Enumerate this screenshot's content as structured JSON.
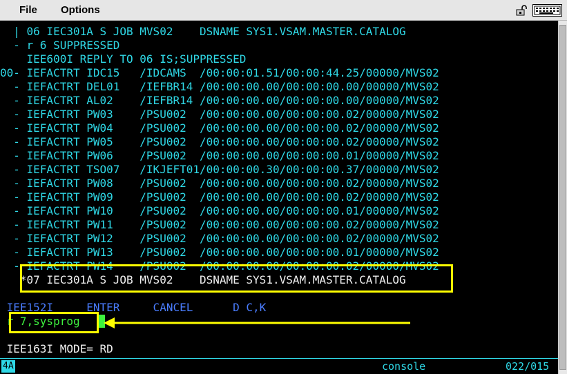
{
  "menubar": {
    "file_label": "File",
    "options_label": "Options",
    "icons": [
      "lock-icon",
      "keyboard-icon"
    ]
  },
  "console_lines": [
    {
      "text": "  | 06 IEC301A S JOB MVS02    DSNAME SYS1.VSAM.MASTER.CATALOG",
      "color": "cyan"
    },
    {
      "text": "  - r 6 SUPPRESSED",
      "color": "cyan"
    },
    {
      "text": "    IEE600I REPLY TO 06 IS;SUPPRESSED",
      "color": "cyan"
    },
    {
      "text": "00- IEFACTRT IDC15   /IDCAMS  /00:00:01.51/00:00:44.25/00000/MVS02",
      "color": "cyan"
    },
    {
      "text": "  - IEFACTRT DEL01   /IEFBR14 /00:00:00.00/00:00:00.00/00000/MVS02",
      "color": "cyan"
    },
    {
      "text": "  - IEFACTRT AL02    /IEFBR14 /00:00:00.00/00:00:00.00/00000/MVS02",
      "color": "cyan"
    },
    {
      "text": "  - IEFACTRT PW03    /PSU002  /00:00:00.00/00:00:00.02/00000/MVS02",
      "color": "cyan"
    },
    {
      "text": "  - IEFACTRT PW04    /PSU002  /00:00:00.00/00:00:00.02/00000/MVS02",
      "color": "cyan"
    },
    {
      "text": "  - IEFACTRT PW05    /PSU002  /00:00:00.00/00:00:00.02/00000/MVS02",
      "color": "cyan"
    },
    {
      "text": "  - IEFACTRT PW06    /PSU002  /00:00:00.00/00:00:00.01/00000/MVS02",
      "color": "cyan"
    },
    {
      "text": "  - IEFACTRT TSO07   /IKJEFT01/00:00:00.30/00:00:00.37/00000/MVS02",
      "color": "cyan"
    },
    {
      "text": "  - IEFACTRT PW08    /PSU002  /00:00:00.00/00:00:00.02/00000/MVS02",
      "color": "cyan"
    },
    {
      "text": "  - IEFACTRT PW09    /PSU002  /00:00:00.00/00:00:00.02/00000/MVS02",
      "color": "cyan"
    },
    {
      "text": "  - IEFACTRT PW10    /PSU002  /00:00:00.00/00:00:00.01/00000/MVS02",
      "color": "cyan"
    },
    {
      "text": "  - IEFACTRT PW11    /PSU002  /00:00:00.00/00:00:00.02/00000/MVS02",
      "color": "cyan"
    },
    {
      "text": "  - IEFACTRT PW12    /PSU002  /00:00:00.00/00:00:00.02/00000/MVS02",
      "color": "cyan"
    },
    {
      "text": "  - IEFACTRT PW13    /PSU002  /00:00:00.00/00:00:00.01/00000/MVS02",
      "color": "cyan"
    },
    {
      "text": "  - IEFACTRT PW14    /PSU002  /00:00:00.00/00:00:00.02/00000/MVS02",
      "color": "cyan"
    },
    {
      "text": "   *07 IEC301A S JOB MVS02    DSNAME SYS1.VSAM.MASTER.CATALOG",
      "color": "white"
    },
    {
      "text": "",
      "color": "cyan"
    },
    {
      "text": " IEE152I     ENTER     CANCEL      D C,K",
      "color": "blue"
    },
    {
      "text": " r 7,sysprog",
      "color": "green"
    },
    {
      "text": "",
      "color": "cyan"
    },
    {
      "text": " IEE163I MODE= RD",
      "color": "white"
    }
  ],
  "input": {
    "command_value": "r 7,sysprog"
  },
  "status_bar": {
    "indicator": "4A",
    "console_label": "console",
    "cursor_position": "022/015"
  },
  "annotation_color": "#ffff00"
}
